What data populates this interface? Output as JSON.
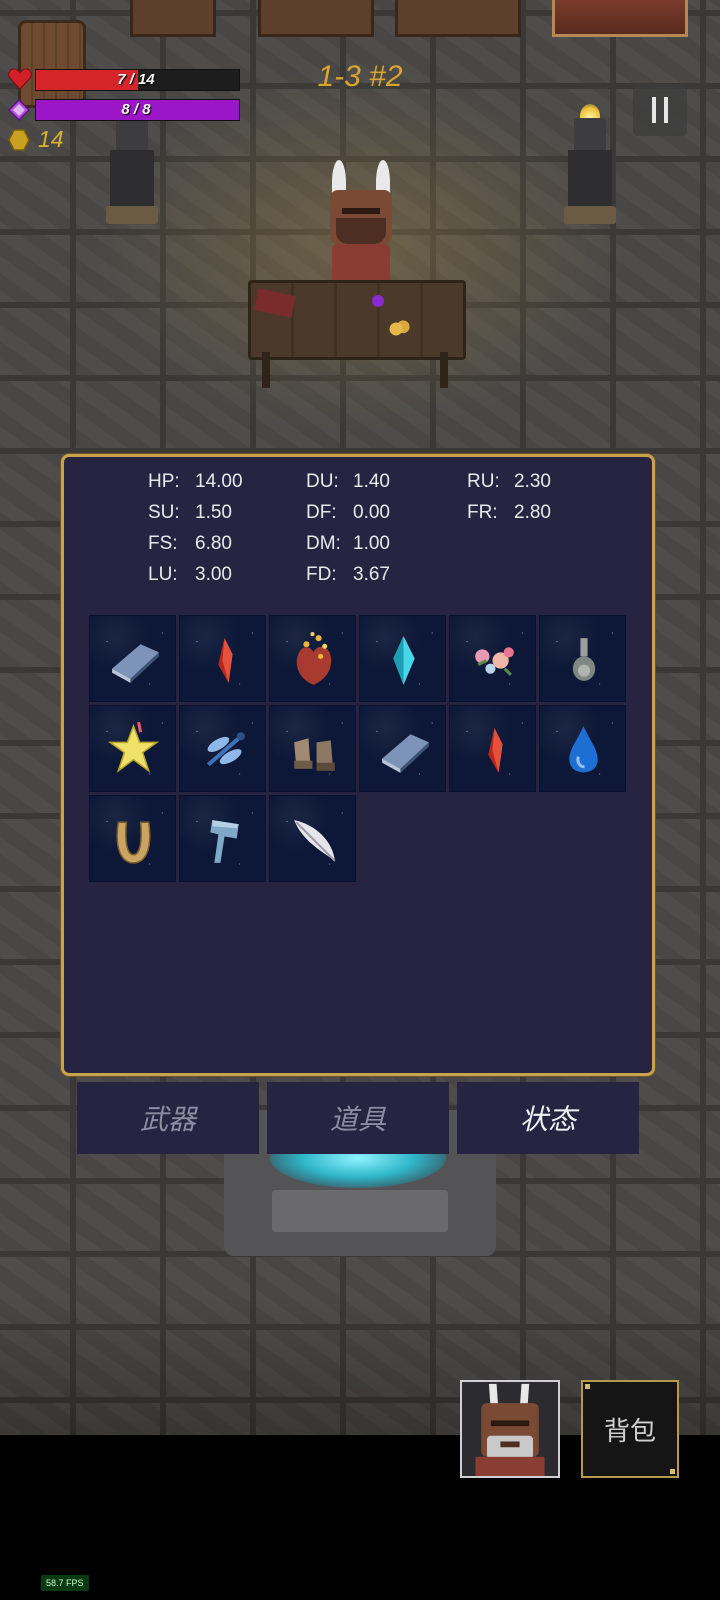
{
  "hud": {
    "hp_text": "7 / 14",
    "hp_fraction": 0.5,
    "mana_text": "8 / 8",
    "mana_fraction": 1.0,
    "gold": "14",
    "stage": "1-3 #2",
    "colors": {
      "hp": "#d4252a",
      "mana": "#9b16c7",
      "gold": "#d6b12f",
      "stage": "#d9a52e"
    }
  },
  "stats": [
    {
      "key": "HP:",
      "value": "14.00"
    },
    {
      "key": "DU:",
      "value": "1.40"
    },
    {
      "key": "RU:",
      "value": "2.30"
    },
    {
      "key": "SU:",
      "value": "1.50"
    },
    {
      "key": "DF:",
      "value": "0.00"
    },
    {
      "key": "FR:",
      "value": "2.80"
    },
    {
      "key": "FS:",
      "value": "6.80"
    },
    {
      "key": "DM:",
      "value": "1.00"
    },
    {
      "key": "LU:",
      "value": "3.00"
    },
    {
      "key": "FD:",
      "value": "3.67"
    }
  ],
  "items": [
    {
      "icon": "blue-book-icon"
    },
    {
      "icon": "red-crystal-icon"
    },
    {
      "icon": "heart-icon"
    },
    {
      "icon": "cyan-crystal-icon"
    },
    {
      "icon": "flowers-icon"
    },
    {
      "icon": "flask-icon"
    },
    {
      "icon": "star-icon"
    },
    {
      "icon": "dragonfly-icon"
    },
    {
      "icon": "boots-icon"
    },
    {
      "icon": "blue-book-icon"
    },
    {
      "icon": "red-crystal-icon"
    },
    {
      "icon": "water-drop-icon"
    },
    {
      "icon": "horseshoe-icon"
    },
    {
      "icon": "axe-icon"
    },
    {
      "icon": "feather-icon"
    }
  ],
  "tabs": [
    {
      "label": "武器",
      "active": false
    },
    {
      "label": "道具",
      "active": false
    },
    {
      "label": "状态",
      "active": true
    }
  ],
  "backpack_label": "背包",
  "fps": "58.7 FPS"
}
